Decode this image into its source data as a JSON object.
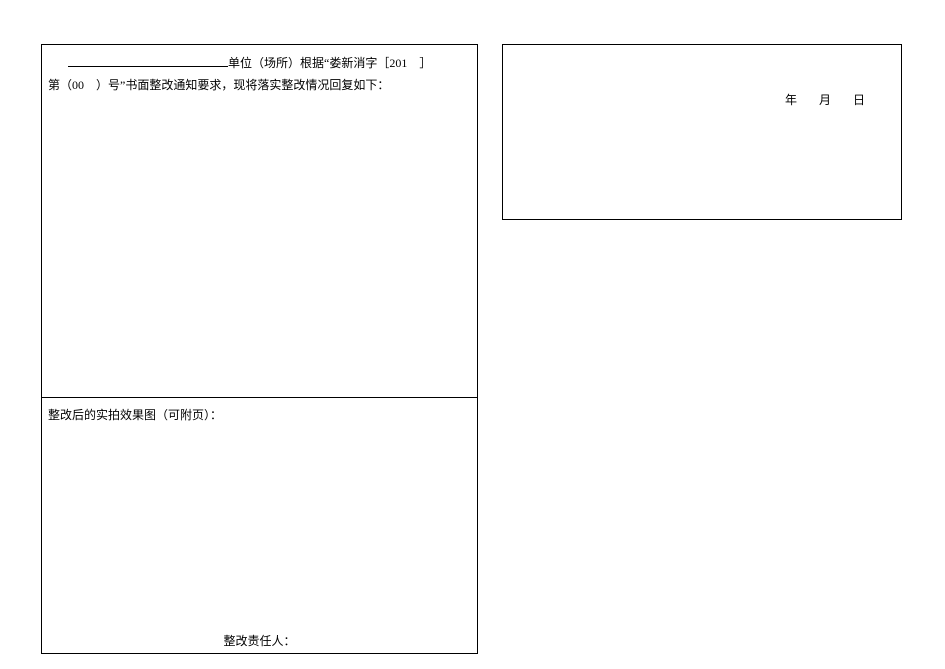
{
  "left": {
    "intro_prefix_blank": "",
    "intro_line1_after_blank": "单位（场所）根据“娄新消字［201　］",
    "intro_line2": "第（00　）号”书面整改通知要求，现将落实整改情况回复如下：",
    "photo_section_label": "整改后的实拍效果图（可附页）：",
    "responsible_label": "整改责任人："
  },
  "right": {
    "date_year_label": "年",
    "date_month_label": "月",
    "date_day_label": "日"
  }
}
